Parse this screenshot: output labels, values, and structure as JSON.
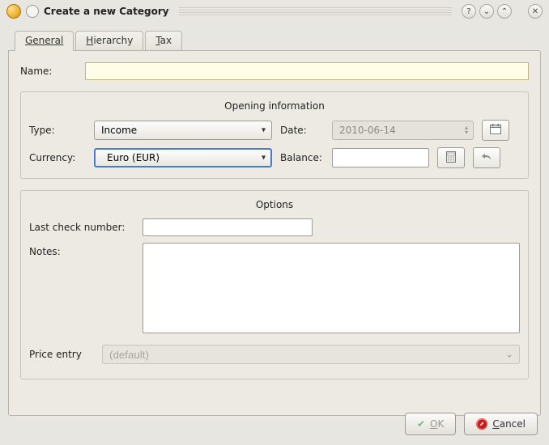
{
  "window": {
    "title": "Create a new Category"
  },
  "tabs": {
    "general": "General",
    "hierarchy": "Hierarchy",
    "tax": "Tax"
  },
  "fields": {
    "name_label": "Name:",
    "name_value": ""
  },
  "opening": {
    "group_title": "Opening information",
    "type_label": "Type:",
    "type_value": "Income",
    "date_label": "Date:",
    "date_value": "2010-06-14",
    "currency_label": "Currency:",
    "currency_value": "Euro (EUR)",
    "balance_label": "Balance:",
    "balance_value": ""
  },
  "options": {
    "group_title": "Options",
    "lcn_label": "Last check number:",
    "lcn_value": "",
    "notes_label": "Notes:",
    "notes_value": "",
    "price_label": "Price entry",
    "price_value": "(default)"
  },
  "buttons": {
    "ok": "OK",
    "cancel": "Cancel"
  }
}
